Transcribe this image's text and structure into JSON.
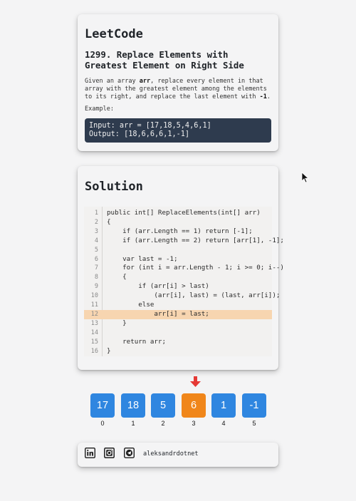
{
  "problem": {
    "brand": "LeetCode",
    "title_line1": "1299. Replace Elements with",
    "title_line2": "Greatest Element on Right Side",
    "desc_line1_pre": "Given an array ",
    "desc_line1_bold": "arr",
    "desc_line1_post": ", replace every element in that",
    "desc_line2": "array with the greatest element among the elements",
    "desc_line3_pre": "to its right, and replace the last element with ",
    "desc_line3_bold": "-1",
    "desc_line3_post": ".",
    "example_label": "Example:",
    "example_input": "Input: arr = [17,18,5,4,6,1]",
    "example_output": "Output: [18,6,6,6,1,-1]"
  },
  "solution": {
    "title": "Solution",
    "highlighted_line": 12,
    "code_lines": [
      {
        "n": "1",
        "t": "public int[] ReplaceElements(int[] arr)"
      },
      {
        "n": "2",
        "t": "{"
      },
      {
        "n": "3",
        "t": "    if (arr.Length == 1) return [-1];"
      },
      {
        "n": "4",
        "t": "    if (arr.Length == 2) return [arr[1], -1];"
      },
      {
        "n": "5",
        "t": ""
      },
      {
        "n": "6",
        "t": "    var last = -1;"
      },
      {
        "n": "7",
        "t": "    for (int i = arr.Length - 1; i >= 0; i--)"
      },
      {
        "n": "8",
        "t": "    {"
      },
      {
        "n": "9",
        "t": "        if (arr[i] > last)"
      },
      {
        "n": "10",
        "t": "            (arr[i], last) = (last, arr[i]);"
      },
      {
        "n": "11",
        "t": "        else"
      },
      {
        "n": "12",
        "t": "            arr[i] = last;"
      },
      {
        "n": "13",
        "t": "    }"
      },
      {
        "n": "14",
        "t": ""
      },
      {
        "n": "15",
        "t": "    return arr;"
      },
      {
        "n": "16",
        "t": "}"
      }
    ]
  },
  "array_view": {
    "active_index": 3,
    "cells": [
      {
        "value": "17",
        "index": "0"
      },
      {
        "value": "18",
        "index": "1"
      },
      {
        "value": "5",
        "index": "2"
      },
      {
        "value": "6",
        "index": "3"
      },
      {
        "value": "1",
        "index": "4"
      },
      {
        "value": "-1",
        "index": "5"
      }
    ],
    "cell_color": "#2f86e0",
    "active_color": "#f0861a",
    "pointer_color": "#e53935"
  },
  "footer": {
    "icons": [
      "linkedin-icon",
      "instagram-icon",
      "telegram-icon"
    ],
    "handle": "aleksandrdotnet"
  }
}
